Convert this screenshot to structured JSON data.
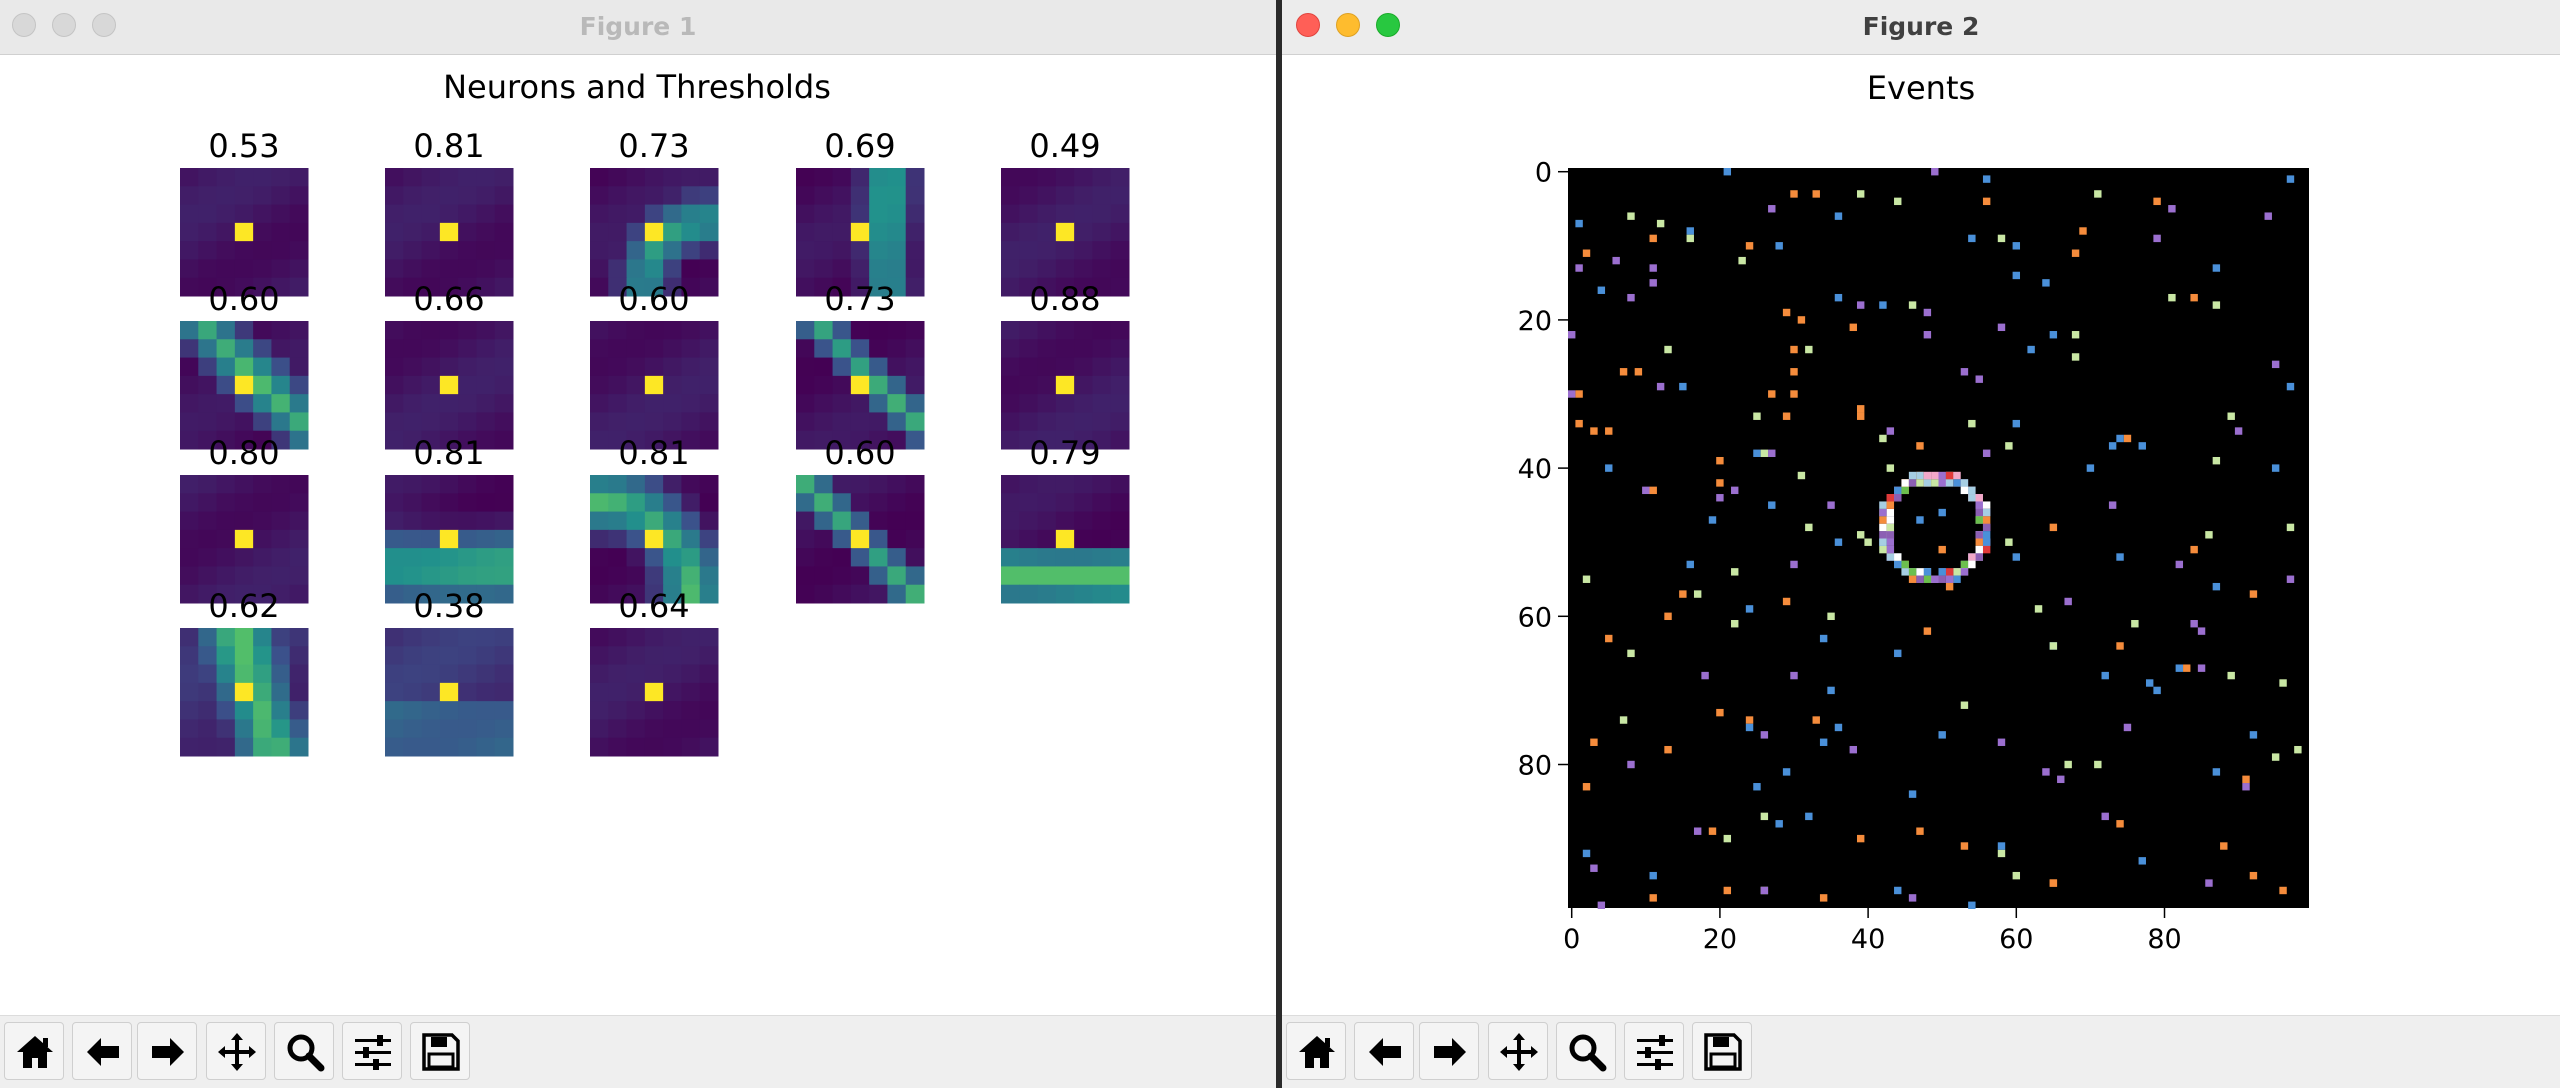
{
  "figure1": {
    "window_title": "Figure 1",
    "plot_title": "Neurons and Thresholds",
    "thresholds": [
      "0.53",
      "0.81",
      "0.73",
      "0.69",
      "0.49",
      "0.60",
      "0.66",
      "0.60",
      "0.73",
      "0.88",
      "0.80",
      "0.81",
      "0.81",
      "0.60",
      "0.79",
      "0.62",
      "0.38",
      "0.64"
    ]
  },
  "figure2": {
    "window_title": "Figure 2",
    "plot_title": "Events",
    "y_ticks": [
      "0",
      "20",
      "40",
      "60",
      "80"
    ],
    "x_ticks": [
      "0",
      "20",
      "40",
      "60",
      "80"
    ]
  },
  "toolbar": {
    "buttons": [
      "home",
      "back",
      "forward",
      "pan",
      "zoom",
      "configure-subplots",
      "save"
    ]
  },
  "colors": {
    "neuron_low": "#46206a",
    "neuron_high": "#fde725",
    "events_bg": "#000000"
  }
}
